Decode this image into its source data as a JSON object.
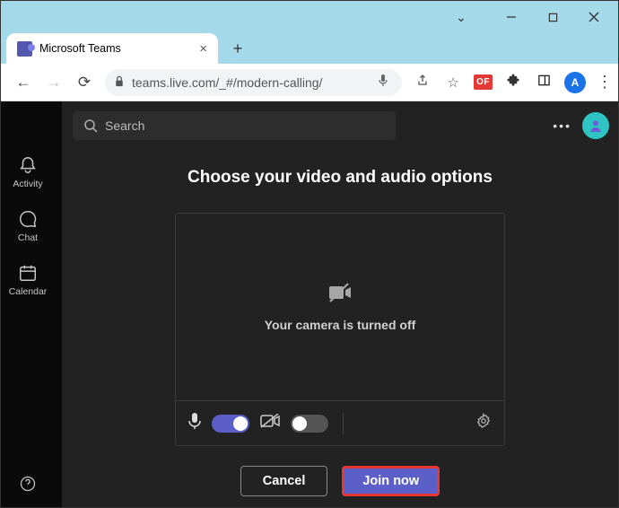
{
  "window": {
    "tab_title": "Microsoft Teams",
    "url": "teams.live.com/_#/modern-calling/",
    "profile_letter": "A",
    "extension_badge": "OF"
  },
  "rail": {
    "activity": "Activity",
    "chat": "Chat",
    "calendar": "Calendar"
  },
  "search": {
    "placeholder": "Search"
  },
  "meeting": {
    "heading": "Choose your video and audio options",
    "camera_off_text": "Your camera is turned off",
    "mic_on": true,
    "camera_on": false,
    "cancel_label": "Cancel",
    "join_label": "Join now"
  }
}
